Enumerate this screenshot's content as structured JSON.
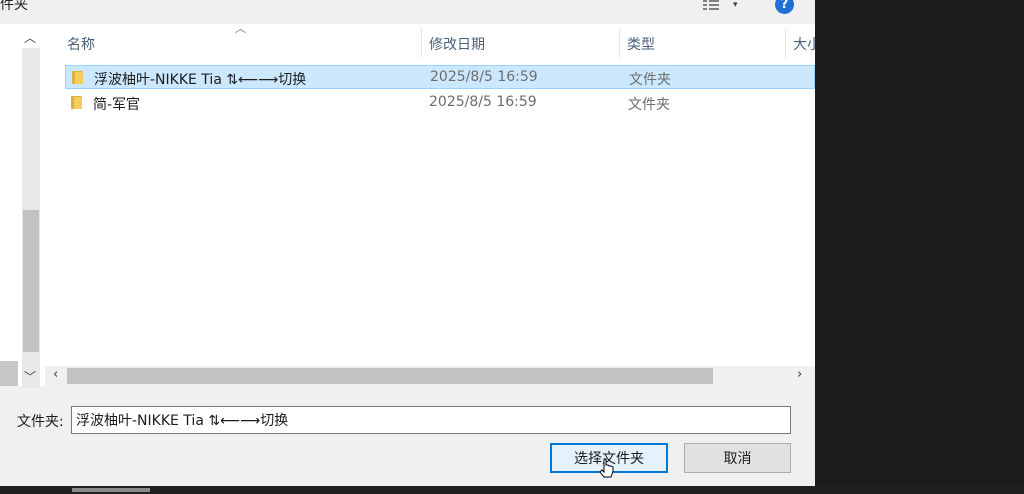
{
  "window": {
    "title_fragment": "件夹"
  },
  "toolbar": {
    "view_arrow": "▾",
    "help": "?"
  },
  "nav_pane": {
    "scroll_up": "︿",
    "scroll_down": "﹀"
  },
  "columns": [
    {
      "label": "名称"
    },
    {
      "label": "修改日期"
    },
    {
      "label": "类型"
    },
    {
      "label": "大小"
    }
  ],
  "sort_indicator": "︿",
  "files": [
    {
      "name": "浮波柚叶-NIKKE Tia ⇅⟵⟶切换",
      "date": "2025/8/5 16:59",
      "type": "文件夹",
      "selected": true
    },
    {
      "name": "简-军官",
      "date": "2025/8/5 16:59",
      "type": "文件夹",
      "selected": false
    }
  ],
  "hscroll": {
    "left": "‹",
    "right": "›"
  },
  "form": {
    "folder_label": "文件夹:",
    "folder_value": "浮波柚叶-NIKKE Tia ⇅⟵⟶切换",
    "select_button": "选择文件夹",
    "cancel_button": "取消"
  },
  "colors": {
    "selection": "#cce8ff",
    "selection_border": "#99d1ff",
    "accent": "#0078d7",
    "folder": "#f4cf5d"
  }
}
